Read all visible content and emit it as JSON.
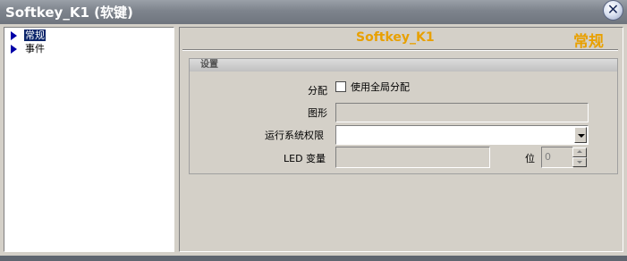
{
  "window": {
    "title": "Softkey_K1 (软键)",
    "close_glyph": "✕",
    "close_icon": "close-icon"
  },
  "tree": {
    "items": [
      {
        "label": "常规",
        "selected": true,
        "icon": "arrow-right-icon"
      },
      {
        "label": "事件",
        "selected": false,
        "icon": "arrow-right-icon"
      }
    ]
  },
  "panel": {
    "object_name": "Softkey_K1",
    "category": "常规",
    "group_title": "设置",
    "assign_label": "分配",
    "assign_checkbox_label": "使用全局分配",
    "assign_checked": false,
    "graphic_label": "图形",
    "graphic_value": "",
    "permission_label": "运行系统权限",
    "permission_value": "",
    "led_label": "LED 变量",
    "led_value": "",
    "bit_label": "位",
    "bit_value": "0"
  },
  "colors": {
    "accent": "#e8a000",
    "selection": "#0a246a",
    "face": "#d4d0c8"
  }
}
